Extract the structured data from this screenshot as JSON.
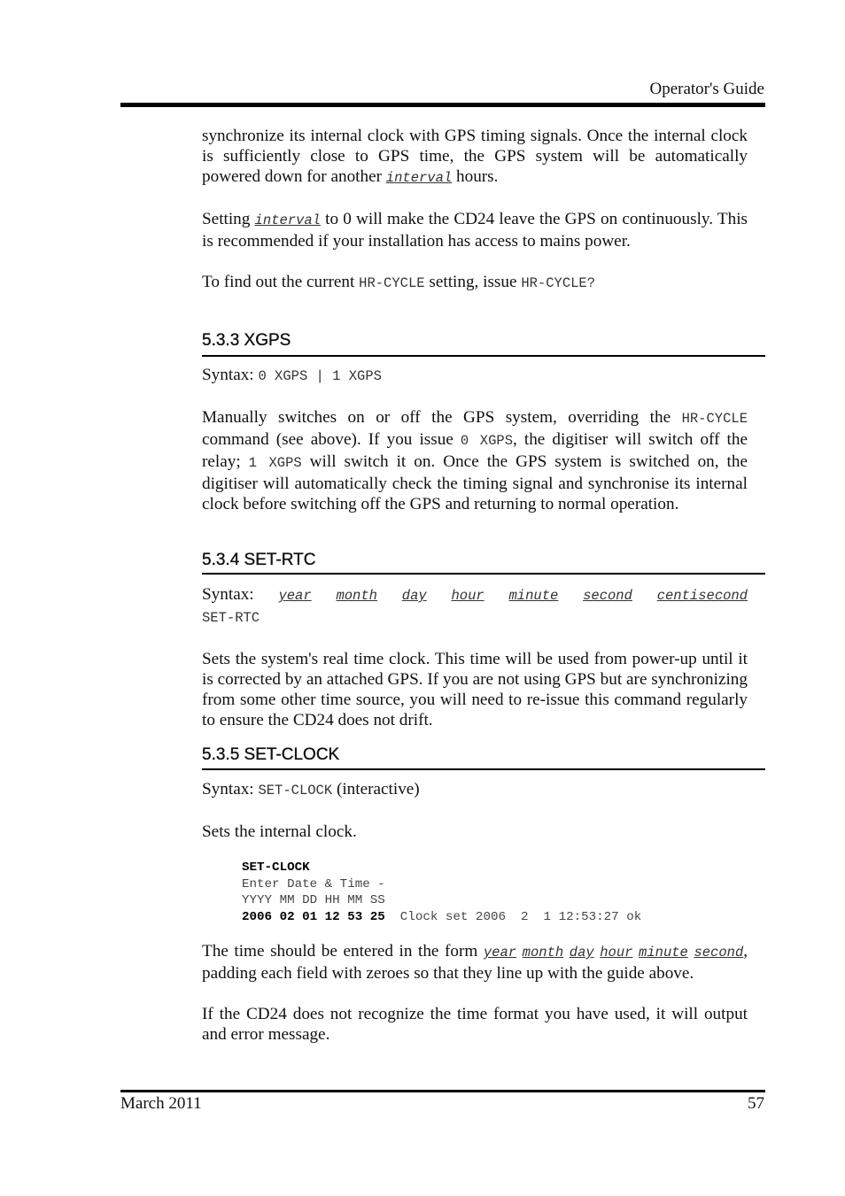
{
  "header": {
    "title": "Operator's Guide"
  },
  "intro": {
    "p1_a": "synchronize its internal clock with GPS timing signals.  Once the internal clock is sufficiently close to GPS time, the GPS system will be automatically powered down for another ",
    "p1_param": "interval",
    "p1_b": " hours.",
    "p2_a": "Setting ",
    "p2_param": "interval",
    "p2_b": " to 0 will make the CD24 leave the GPS on continuously.  This is recommended if your installation has access to mains power.",
    "p3_a": "To find out the current ",
    "p3_code1": "HR-CYCLE",
    "p3_b": " setting, issue ",
    "p3_code2": "HR-CYCLE?"
  },
  "sections": [
    {
      "heading": "5.3.3  XGPS",
      "syntax_label": "Syntax: ",
      "syntax_code": "0 XGPS | 1 XGPS",
      "body_a": "Manually switches on or off the GPS system, overriding the ",
      "body_code1": "HR-CYCLE",
      "body_b": " command (see above).  If you issue ",
      "body_code2": "0 XGPS",
      "body_c": ", the digitiser will switch off the relay; ",
      "body_code3": "1 XGPS",
      "body_d": " will switch it on.  Once the GPS system is switched on, the digitiser will automatically check the timing signal and synchronise its internal clock before switching off the GPS and returning to normal operation."
    },
    {
      "heading": "5.3.4  SET-RTC",
      "syntax_label": "Syntax: ",
      "syntax_params": [
        "year",
        "month",
        "day",
        "hour",
        "minute",
        "second",
        "centisecond"
      ],
      "syntax_code": "SET-RTC",
      "body": "Sets the system's real time clock.  This time will be used from power-up until it is corrected by an attached GPS.  If you are not using GPS but are synchronizing from some other time source, you will need to re-issue this command regularly to ensure the CD24 does not drift."
    },
    {
      "heading": "5.3.5  SET-CLOCK",
      "syntax_label": "Syntax: ",
      "syntax_code": "SET-CLOCK",
      "syntax_suffix": " (interactive)",
      "body1": "Sets the internal clock.",
      "code_lines": {
        "l1": "SET-CLOCK",
        "l2": "Enter Date & Time -",
        "l3": "YYYY MM DD HH MM SS",
        "l4_input": "2006 02 01 12 53 25",
        "l4_output": "  Clock set 2006  2  1 12:53:27 ok"
      },
      "body2_a": "The time should be entered in the form ",
      "body2_params": [
        "year",
        "month",
        "day",
        "hour",
        "minute",
        "second"
      ],
      "body2_b": ", padding each field with zeroes so that they line up with the guide above.",
      "body3": "If the CD24 does not recognize the time format you have used, it will output and error message."
    }
  ],
  "footer": {
    "date": "March 2011",
    "page_number": "57"
  }
}
